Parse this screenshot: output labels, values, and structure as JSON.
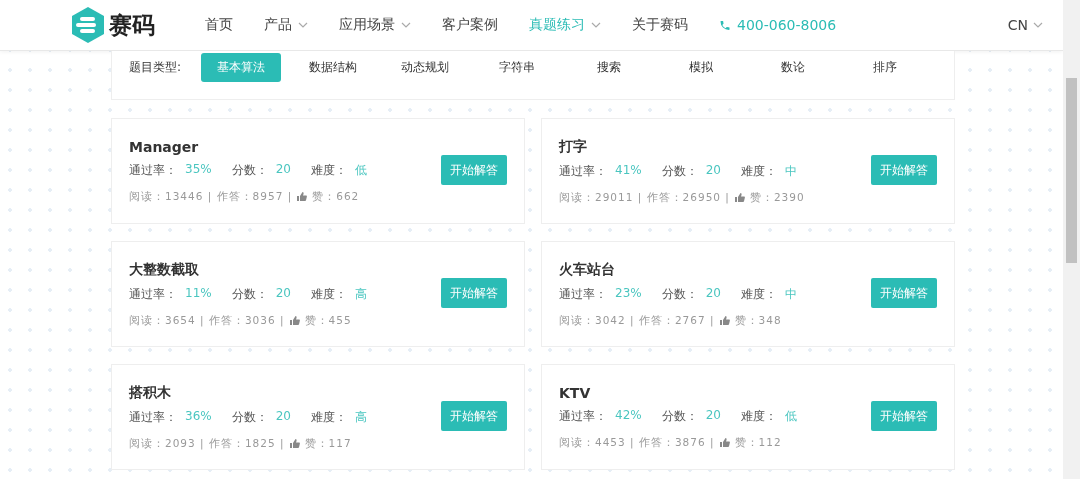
{
  "header": {
    "logo_text": "赛码",
    "nav": [
      {
        "label": "首页",
        "selected": false,
        "dropdown": false
      },
      {
        "label": "产品",
        "selected": false,
        "dropdown": true
      },
      {
        "label": "应用场景",
        "selected": false,
        "dropdown": true
      },
      {
        "label": "客户案例",
        "selected": false,
        "dropdown": false
      },
      {
        "label": "真题练习",
        "selected": true,
        "dropdown": true
      },
      {
        "label": "关于赛码",
        "selected": false,
        "dropdown": false
      }
    ],
    "phone": "400-060-8006",
    "language": "CN"
  },
  "filter": {
    "label": "题目类型:",
    "tabs": [
      {
        "label": "基本算法",
        "selected": true
      },
      {
        "label": "数据结构",
        "selected": false
      },
      {
        "label": "动态规划",
        "selected": false
      },
      {
        "label": "字符串",
        "selected": false
      },
      {
        "label": "搜索",
        "selected": false
      },
      {
        "label": "模拟",
        "selected": false
      },
      {
        "label": "数论",
        "selected": false
      },
      {
        "label": "排序",
        "selected": false
      }
    ]
  },
  "problems": [
    {
      "title": "Manager",
      "metrics": [
        {
          "label": "通过率：",
          "value": "35%"
        },
        {
          "label": "分数：",
          "value": "20"
        },
        {
          "label": "难度：",
          "value": "低"
        }
      ],
      "stats": "阅读：13446 | 作答：8957 |",
      "likes": "赞：662",
      "button": "开始解答"
    },
    {
      "title": "打字",
      "metrics": [
        {
          "label": "通过率：",
          "value": "41%"
        },
        {
          "label": "分数：",
          "value": "20"
        },
        {
          "label": "难度：",
          "value": "中"
        }
      ],
      "stats": "阅读：29011 | 作答：26950 |",
      "likes": "赞：2390",
      "button": "开始解答"
    },
    {
      "title": "大整数截取",
      "metrics": [
        {
          "label": "通过率：",
          "value": "11%"
        },
        {
          "label": "分数：",
          "value": "20"
        },
        {
          "label": "难度：",
          "value": "高"
        }
      ],
      "stats": "阅读：3654 | 作答：3036 |",
      "likes": "赞：455",
      "button": "开始解答"
    },
    {
      "title": "火车站台",
      "metrics": [
        {
          "label": "通过率：",
          "value": "23%"
        },
        {
          "label": "分数：",
          "value": "20"
        },
        {
          "label": "难度：",
          "value": "中"
        }
      ],
      "stats": "阅读：3042 | 作答：2767 |",
      "likes": "赞：348",
      "button": "开始解答"
    },
    {
      "title": "搭积木",
      "metrics": [
        {
          "label": "通过率：",
          "value": "36%"
        },
        {
          "label": "分数：",
          "value": "20"
        },
        {
          "label": "难度：",
          "value": "高"
        }
      ],
      "stats": "阅读：2093 | 作答：1825 |",
      "likes": "赞：117",
      "button": "开始解答"
    },
    {
      "title": "KTV",
      "metrics": [
        {
          "label": "通过率：",
          "value": "42%"
        },
        {
          "label": "分数：",
          "value": "20"
        },
        {
          "label": "难度：",
          "value": "低"
        }
      ],
      "stats": "阅读：4453 | 作答：3876 |",
      "likes": "赞：112",
      "button": "开始解答"
    }
  ]
}
